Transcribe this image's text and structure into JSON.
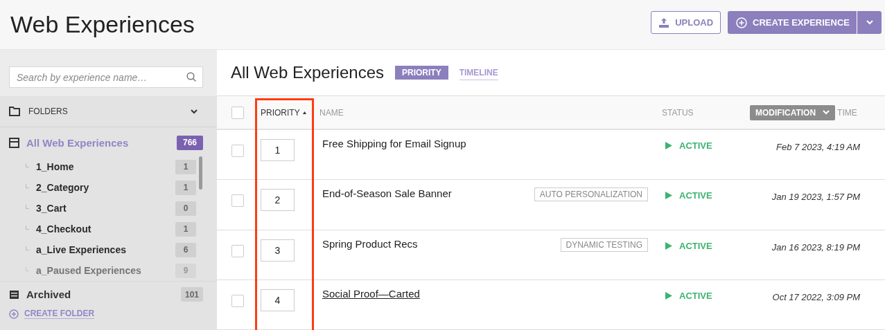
{
  "page_title": "Web Experiences",
  "header_buttons": {
    "upload": "UPLOAD",
    "create": "CREATE EXPERIENCE"
  },
  "sidebar": {
    "search": {
      "placeholder": "Search by experience name…"
    },
    "folders_label": "FOLDERS",
    "tree": [
      {
        "label": "All Web Experiences",
        "count": "766",
        "selected": true,
        "children": [
          {
            "label": "1_Home",
            "count": "1",
            "selected": false,
            "faded": false
          },
          {
            "label": "2_Category",
            "count": "1",
            "selected": false,
            "faded": false
          },
          {
            "label": "3_Cart",
            "count": "0",
            "selected": false,
            "faded": false
          },
          {
            "label": "4_Checkout",
            "count": "1",
            "selected": false,
            "faded": false
          },
          {
            "label": "a_Live Experiences",
            "count": "6",
            "selected": false,
            "faded": false
          },
          {
            "label": "a_Paused Experiences",
            "count": "9",
            "selected": false,
            "faded": true
          }
        ]
      }
    ],
    "archived": {
      "label": "Archived",
      "count": "101"
    },
    "create_folder": "CREATE FOLDER"
  },
  "main": {
    "title": "All Web Experiences",
    "views": [
      {
        "label": "PRIORITY",
        "selected": true
      },
      {
        "label": "TIMELINE",
        "selected": false
      }
    ],
    "select_all_checked": false,
    "columns": {
      "priority": "PRIORITY",
      "name": "NAME",
      "status": "STATUS",
      "sort_by": "MODIFICATION",
      "time": "TIME"
    },
    "rows": [
      {
        "checked": false,
        "priority": "1",
        "name": "Free Shipping for Email Signup",
        "hovered": false,
        "status": "ACTIVE",
        "time": "Feb 7 2023, 4:19 AM"
      },
      {
        "checked": false,
        "priority": "2",
        "name": "End-of-Season Sale Banner",
        "hovered": false,
        "tag": "AUTO PERSONALIZATION",
        "status": "ACTIVE",
        "time": "Jan 19 2023, 1:57 PM"
      },
      {
        "checked": false,
        "priority": "3",
        "name": "Spring Product Recs",
        "hovered": false,
        "tag": "DYNAMIC TESTING",
        "status": "ACTIVE",
        "time": "Jan 16 2023, 8:19 PM"
      },
      {
        "checked": false,
        "priority": "4",
        "name": "Social Proof—Carted",
        "hovered": true,
        "status": "ACTIVE",
        "time": "Oct 17 2022, 3:09 PM"
      }
    ]
  }
}
